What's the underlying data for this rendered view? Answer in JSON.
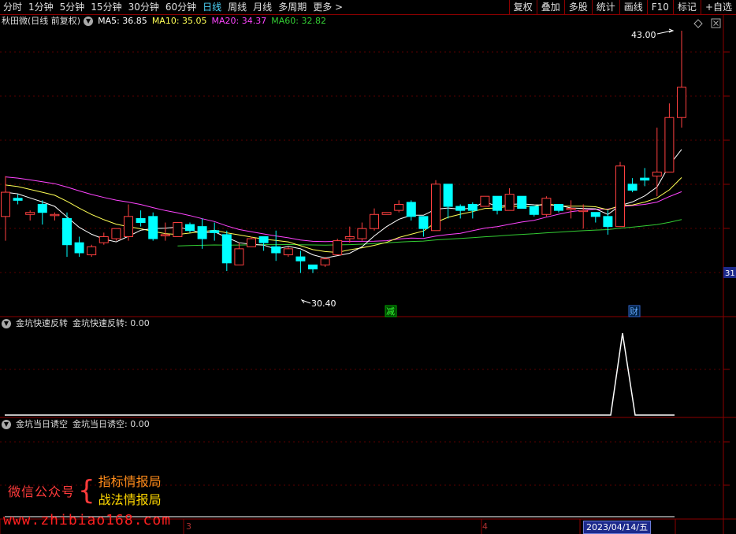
{
  "toolbar": {
    "periods": [
      "分时",
      "1分钟",
      "5分钟",
      "15分钟",
      "30分钟",
      "60分钟",
      "日线",
      "周线",
      "月线",
      "多周期",
      "更多"
    ],
    "selected_period": "日线",
    "right_buttons": [
      "复权",
      "叠加",
      "多股",
      "统计",
      "画线",
      "F10",
      "标记",
      "+自选"
    ]
  },
  "main_legend": {
    "title": "秋田微(日线 前复权)",
    "ma5": "MA5: 36.85",
    "ma10": "MA10: 35.05",
    "ma20": "MA20: 34.37",
    "ma60": "MA60: 32.82"
  },
  "labels": {
    "high": "43.00",
    "low": "30.40",
    "event_jian": "减",
    "event_cai": "财",
    "right_axis": "31"
  },
  "indicator1": {
    "name": "金坑快速反转",
    "value": "金坑快速反转: 0.00"
  },
  "indicator2": {
    "name": "金坑当日诱空",
    "value": "金坑当日诱空: 0.00"
  },
  "ad": {
    "brand": "微信公众号",
    "line1": "指标情报局",
    "line2": "战法情报局"
  },
  "watermark": "www.zhibiao168.com",
  "bottom_axis": {
    "month3": "3",
    "month4": "4",
    "cursor_date": "2023/04/14/五"
  },
  "colors": {
    "up": "#ff4040",
    "down": "#00ffff",
    "ma5": "#ffffff",
    "ma10": "#ffff55",
    "ma20": "#ff44ff",
    "ma60": "#33cc33"
  },
  "chart_data": {
    "type": "candlestick",
    "candles": [
      [
        33.8,
        35.0,
        32.6,
        35.8
      ],
      [
        34.7,
        34.6,
        34.4,
        34.9
      ],
      [
        33.9,
        34.0,
        33.6,
        34.1
      ],
      [
        34.4,
        34.0,
        33.4,
        34.6
      ],
      [
        33.9,
        33.9,
        33.6,
        34.0
      ],
      [
        33.7,
        32.4,
        31.8,
        34.0
      ],
      [
        32.5,
        32.0,
        31.8,
        32.8
      ],
      [
        31.9,
        32.3,
        31.8,
        32.4
      ],
      [
        32.5,
        32.8,
        32.4,
        33.0
      ],
      [
        32.7,
        33.2,
        32.6,
        33.2
      ],
      [
        32.8,
        33.8,
        32.6,
        34.4
      ],
      [
        33.7,
        33.5,
        33.3,
        34.1
      ],
      [
        33.8,
        32.7,
        32.6,
        34.0
      ],
      [
        32.9,
        32.9,
        32.6,
        33.5
      ],
      [
        32.8,
        33.5,
        32.8,
        33.5
      ],
      [
        33.4,
        33.1,
        33.0,
        33.5
      ],
      [
        33.3,
        32.7,
        32.2,
        33.7
      ],
      [
        33.1,
        33.0,
        32.6,
        33.5
      ],
      [
        32.9,
        31.5,
        31.1,
        33.1
      ],
      [
        31.4,
        32.2,
        31.4,
        32.5
      ],
      [
        32.3,
        32.7,
        32.3,
        32.8
      ],
      [
        32.8,
        32.5,
        32.1,
        32.8
      ],
      [
        32.3,
        32.0,
        31.6,
        33.1
      ],
      [
        31.9,
        32.2,
        31.8,
        32.3
      ],
      [
        31.8,
        31.6,
        31.0,
        32.1
      ],
      [
        31.4,
        31.2,
        31.0,
        31.4
      ],
      [
        31.4,
        31.7,
        31.3,
        31.8
      ],
      [
        31.9,
        32.6,
        31.9,
        32.7
      ],
      [
        32.7,
        32.8,
        32.5,
        33.3
      ],
      [
        32.7,
        33.2,
        32.6,
        33.5
      ],
      [
        33.2,
        33.9,
        33.1,
        34.2
      ],
      [
        33.9,
        34.0,
        33.9,
        34.0
      ],
      [
        34.1,
        34.4,
        34.0,
        34.6
      ],
      [
        34.5,
        33.8,
        33.6,
        34.6
      ],
      [
        33.8,
        33.2,
        32.8,
        33.8
      ],
      [
        33.1,
        35.4,
        33.1,
        35.6
      ],
      [
        35.4,
        34.3,
        33.7,
        35.4
      ],
      [
        34.3,
        34.1,
        33.7,
        34.4
      ],
      [
        34.4,
        34.1,
        33.7,
        34.5
      ],
      [
        34.3,
        34.8,
        34.3,
        34.8
      ],
      [
        34.8,
        34.1,
        33.9,
        34.8
      ],
      [
        34.1,
        34.9,
        34.2,
        35.2
      ],
      [
        34.8,
        34.2,
        34.2,
        34.8
      ],
      [
        34.3,
        33.9,
        33.8,
        34.3
      ],
      [
        33.9,
        34.7,
        33.8,
        34.8
      ],
      [
        34.4,
        34.1,
        34.0,
        34.4
      ],
      [
        34.2,
        34.2,
        33.7,
        34.6
      ],
      [
        34.1,
        34.1,
        33.2,
        34.4
      ],
      [
        34.0,
        33.8,
        33.5,
        34.0
      ],
      [
        33.8,
        33.3,
        32.9,
        34.1
      ],
      [
        33.3,
        36.3,
        33.3,
        36.5
      ],
      [
        35.4,
        35.1,
        35.0,
        35.7
      ],
      [
        35.7,
        35.6,
        35.3,
        36.2
      ],
      [
        35.8,
        36.0,
        34.8,
        38.2
      ],
      [
        36.0,
        38.7,
        36.0,
        39.4
      ],
      [
        38.7,
        40.2,
        38.2,
        43.0
      ]
    ]
  }
}
